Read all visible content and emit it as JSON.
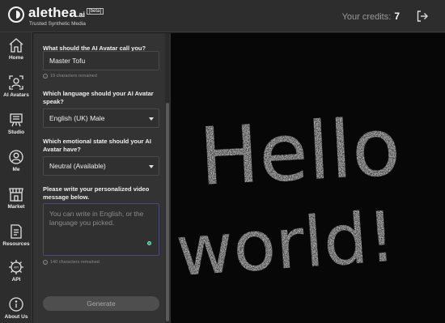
{
  "header": {
    "brand_name": "alethea",
    "brand_suffix": ".ai",
    "beta_badge": "[beta]",
    "tagline": "Trusted Synthetic Media",
    "credits_label": "Your credits:",
    "credits_value": "7",
    "logout_icon": "logout-icon"
  },
  "sidebar": {
    "items": [
      {
        "label": "Home",
        "icon": "home-icon"
      },
      {
        "label": "AI Avatars",
        "icon": "avatar-icon"
      },
      {
        "label": "Studio",
        "icon": "studio-icon"
      },
      {
        "label": "Me",
        "icon": "user-icon"
      },
      {
        "label": "Market",
        "icon": "market-icon"
      },
      {
        "label": "Resources",
        "icon": "resources-icon"
      },
      {
        "label": "API",
        "icon": "api-icon"
      },
      {
        "label": "About Us",
        "icon": "info-icon"
      }
    ]
  },
  "form": {
    "name_question": "What should the AI Avatar call you?",
    "name_value": "Master Tofu",
    "name_hint": "19 characters remained",
    "language_question": "Which language should your AI Avatar speak?",
    "language_value": "English (UK) Male",
    "emotion_question": "Which emotional state should your AI Avatar have?",
    "emotion_value": "Neutral (Available)",
    "message_question": "Please write your personalized video message below.",
    "message_placeholder": "You can write in English, or the language you picked.",
    "message_hint": "140 characters remained",
    "generate_label": "Generate"
  },
  "video": {
    "text_line1": "Hello",
    "text_line2": "world!"
  },
  "colors": {
    "header_bg": "#2d2d2d",
    "panel_bg": "#333333",
    "video_bg": "#070707",
    "accent_green": "#1ea47c"
  }
}
